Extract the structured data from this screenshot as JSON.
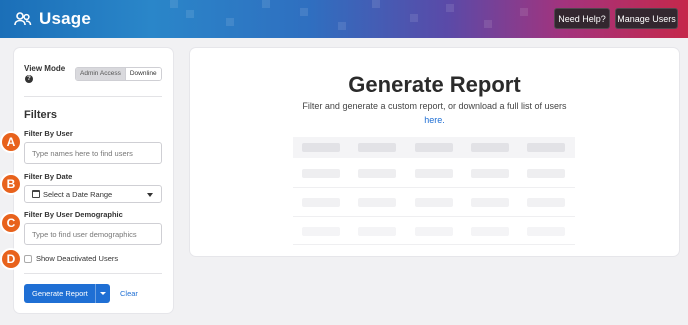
{
  "header": {
    "app_title": "Usage",
    "brand_icon": "users-icon",
    "help_label": "Need Help?",
    "manage_label": "Manage Users",
    "colors": {
      "start": "#1b6fb8",
      "end": "#c5284b"
    }
  },
  "sidebar": {
    "view_mode_label": "View Mode",
    "view_mode_help_icon": "question-circle-icon",
    "view_mode_options": [
      "Admin Access",
      "Downline"
    ],
    "view_mode_selected": "Admin Access",
    "filters_title": "Filters",
    "filter_user": {
      "label": "Filter By User",
      "placeholder": "Type names here to find users",
      "value": ""
    },
    "filter_date": {
      "label": "Filter By Date",
      "selected": "Select a Date Range",
      "icon": "calendar-icon"
    },
    "filter_demographic": {
      "label": "Filter By User Demographic",
      "placeholder": "Type to find user demographics",
      "value": ""
    },
    "show_deactivated": {
      "label": "Show Deactivated Users",
      "checked": false
    },
    "generate_label": "Generate Report",
    "clear_label": "Clear"
  },
  "markers": [
    "A",
    "B",
    "C",
    "D"
  ],
  "main": {
    "title": "Generate Report",
    "subtitle": "Filter and generate a custom report, or download a full list of users",
    "link_text": "here."
  },
  "colors": {
    "accent": "#1f6fd4",
    "marker": "#e8621c"
  }
}
